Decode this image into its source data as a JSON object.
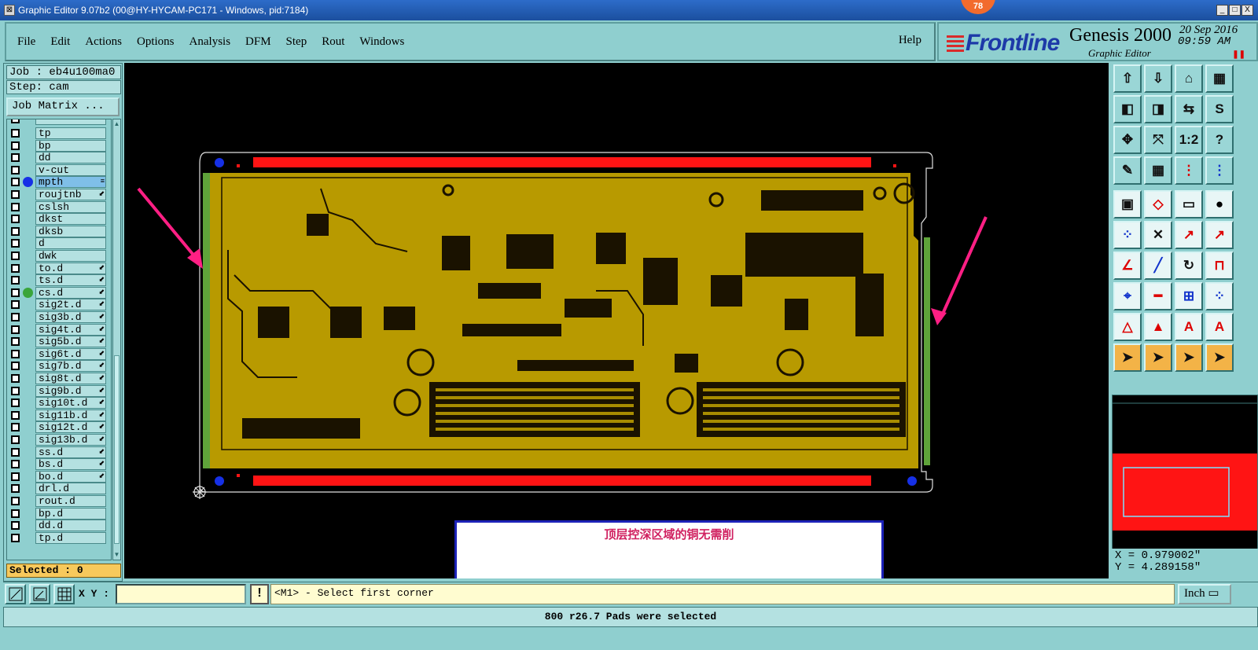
{
  "window": {
    "title": "Graphic Editor 9.07b2 (00@HY-HYCAM-PC171 - Windows, pid:7184)",
    "badge": "78",
    "buttons": {
      "min": "_",
      "max": "□",
      "close": "X"
    }
  },
  "menu": [
    "File",
    "Edit",
    "Actions",
    "Options",
    "Analysis",
    "DFM",
    "Step",
    "Rout",
    "Windows"
  ],
  "help": "Help",
  "brand": {
    "logo": "Frontline",
    "product": "Genesis 2000",
    "subtitle": "Graphic Editor",
    "date": "20 Sep 2016",
    "time": "09:59 AM"
  },
  "job": {
    "job_line": "Job : eb4u100ma0",
    "step_line": "Step: cam",
    "job_matrix": "Job Matrix ..."
  },
  "layers": [
    {
      "name": "tp",
      "dot": "",
      "icon": ""
    },
    {
      "name": "bp",
      "dot": "",
      "icon": ""
    },
    {
      "name": "dd",
      "dot": "",
      "icon": ""
    },
    {
      "name": "v-cut",
      "dot": "",
      "icon": ""
    },
    {
      "name": "mpth",
      "dot": "#1630e6",
      "icon": "≡",
      "active": true
    },
    {
      "name": "roujtnb",
      "dot": "",
      "icon": "⬋"
    },
    {
      "name": "cslsh",
      "dot": "",
      "icon": ""
    },
    {
      "name": "dkst",
      "dot": "",
      "icon": ""
    },
    {
      "name": "dksb",
      "dot": "",
      "icon": ""
    },
    {
      "name": "d",
      "dot": "",
      "icon": ""
    },
    {
      "name": "dwk",
      "dot": "",
      "icon": ""
    },
    {
      "name": "to.d",
      "dot": "",
      "icon": "⬋"
    },
    {
      "name": "ts.d",
      "dot": "",
      "icon": "⬋"
    },
    {
      "name": "cs.d",
      "dot": "#3aa53a",
      "icon": "⬋"
    },
    {
      "name": "sig2t.d",
      "dot": "",
      "icon": "⬋"
    },
    {
      "name": "sig3b.d",
      "dot": "",
      "icon": "⬋"
    },
    {
      "name": "sig4t.d",
      "dot": "",
      "icon": "⬋"
    },
    {
      "name": "sig5b.d",
      "dot": "",
      "icon": "⬋"
    },
    {
      "name": "sig6t.d",
      "dot": "",
      "icon": "⬋"
    },
    {
      "name": "sig7b.d",
      "dot": "",
      "icon": "⬋"
    },
    {
      "name": "sig8t.d",
      "dot": "",
      "icon": "⬋"
    },
    {
      "name": "sig9b.d",
      "dot": "",
      "icon": "⬋"
    },
    {
      "name": "sig10t.d",
      "dot": "",
      "icon": "⬋"
    },
    {
      "name": "sig11b.d",
      "dot": "",
      "icon": "⬋"
    },
    {
      "name": "sig12t.d",
      "dot": "",
      "icon": "⬋"
    },
    {
      "name": "sig13b.d",
      "dot": "",
      "icon": "⬋"
    },
    {
      "name": "ss.d",
      "dot": "",
      "icon": "⬋"
    },
    {
      "name": "bs.d",
      "dot": "",
      "icon": "⬋"
    },
    {
      "name": "bo.d",
      "dot": "",
      "icon": "⬋"
    },
    {
      "name": "drl.d",
      "dot": "",
      "icon": ""
    },
    {
      "name": "rout.d",
      "dot": "",
      "icon": ""
    },
    {
      "name": "bp.d",
      "dot": "",
      "icon": ""
    },
    {
      "name": "dd.d",
      "dot": "",
      "icon": ""
    },
    {
      "name": "tp.d",
      "dot": "",
      "icon": ""
    }
  ],
  "selected": "Selected : 0",
  "annotation": "顶层控深区域的铜无需削",
  "coords": {
    "x": "X =  0.979002\"",
    "y": "Y =  4.289158\""
  },
  "command": {
    "xy_label": "X Y :",
    "xy_value": "",
    "bang": "!",
    "prompt": "<M1> - Select first corner",
    "units": "Inch"
  },
  "status": "800 r26.7 Pads were selected",
  "colors": {
    "board": "#b89a00",
    "board_edge": "#5fa33a",
    "rail": "#ff1414",
    "fiducial": "#1630e6",
    "arrow": "#ff1f84"
  },
  "tools": [
    "move-up-icon",
    "move-down-icon",
    "home-icon",
    "zoom-window-icon",
    "left-icon",
    "right-icon",
    "flip-icon",
    "snake-icon",
    "fit-all-icon",
    "fit-icon",
    "scale-icon",
    "query-icon",
    "measure-icon",
    "grid-icon",
    "layers-red-icon",
    "layers-blue-icon",
    "pad-icon",
    "polygon-icon",
    "ruler-icon",
    "dot-icon",
    "connect-icon",
    "cross-icon",
    "arc-icon",
    "arc2-icon",
    "line-icon",
    "line2-icon",
    "rotate-icon",
    "split-icon",
    "transform-icon",
    "minus-icon",
    "box-icon",
    "group-icon",
    "triangle-icon",
    "triangle2-icon",
    "triangle3-icon",
    "triangle4-icon",
    "select-icon",
    "select-box-icon",
    "select-poly-icon",
    "select-net-icon"
  ]
}
